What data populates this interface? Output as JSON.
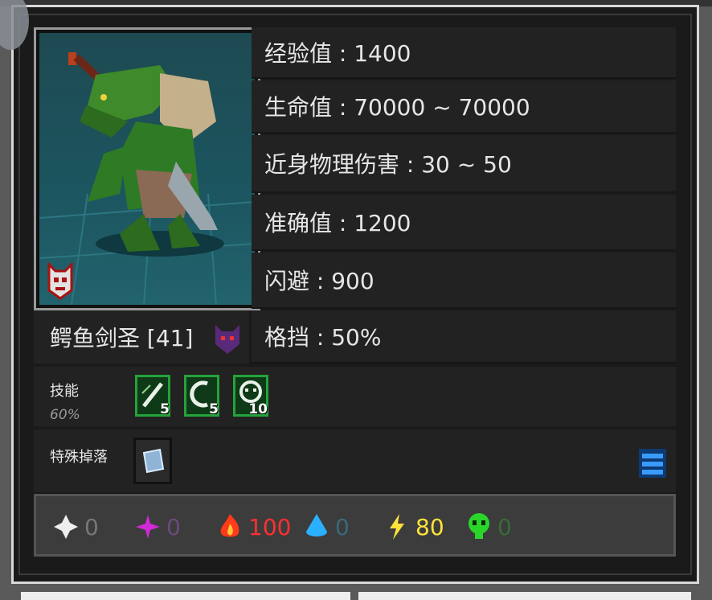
{
  "stats": [
    {
      "label": "经验值 : 1400"
    },
    {
      "label": "生命值 : 70000 ~ 70000"
    },
    {
      "label": "近身物理伤害 : 30 ~ 50"
    },
    {
      "label": "准确值 : 1200"
    },
    {
      "label": "闪避 : 900"
    },
    {
      "label": "格挡 : 50%"
    }
  ],
  "monster": {
    "name": "鳄鱼剑圣 [41]"
  },
  "skills": {
    "label": "技能",
    "rate": "60%",
    "items": [
      {
        "count": "5",
        "icon": "sword-slash-icon"
      },
      {
        "count": "5",
        "icon": "wave-icon"
      },
      {
        "count": "10",
        "icon": "beast-icon"
      }
    ]
  },
  "special_drop": {
    "label": "特殊掉落",
    "item_icon": "gem-icon"
  },
  "resistances": [
    {
      "icon": "shuriken-icon",
      "value": "0",
      "color": "#777777"
    },
    {
      "icon": "magic-star-icon",
      "value": "0",
      "color": "#6a4a7a"
    },
    {
      "icon": "fire-icon",
      "value": "100",
      "color": "#ff3030"
    },
    {
      "icon": "water-drop-icon",
      "value": "0",
      "color": "#3a6a7a"
    },
    {
      "icon": "lightning-icon",
      "value": "80",
      "color": "#ffe23a"
    },
    {
      "icon": "poison-skull-icon",
      "value": "0",
      "color": "#3a6a3a"
    }
  ]
}
